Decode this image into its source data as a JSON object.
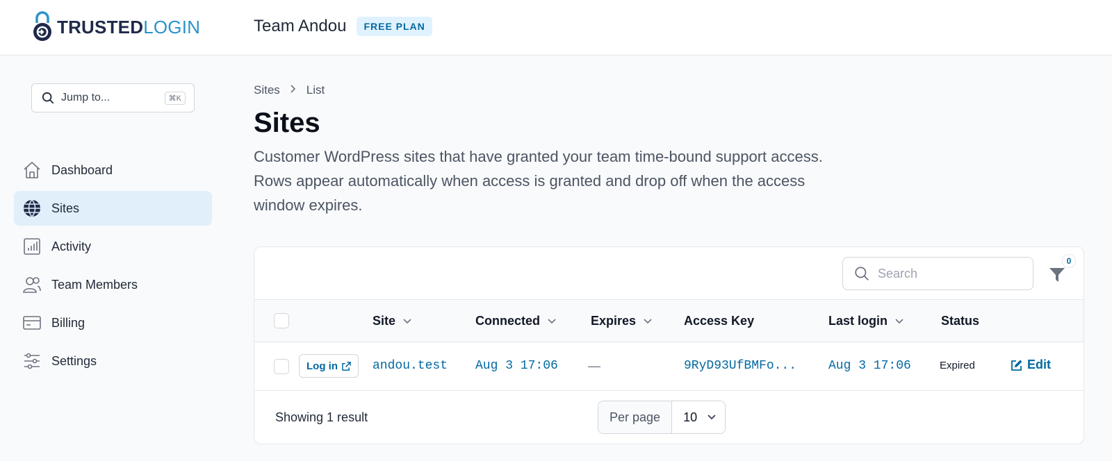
{
  "header": {
    "logo_part1": "TRUSTED",
    "logo_part2": "LOGIN",
    "team_name": "Team Andou",
    "plan_badge": "FREE PLAN"
  },
  "sidebar": {
    "jump_placeholder": "Jump to...",
    "jump_shortcut": "⌘K",
    "items": [
      {
        "label": "Dashboard",
        "icon": "home-icon",
        "active": false
      },
      {
        "label": "Sites",
        "icon": "globe-icon",
        "active": true
      },
      {
        "label": "Activity",
        "icon": "bar-chart-icon",
        "active": false
      },
      {
        "label": "Team Members",
        "icon": "users-icon",
        "active": false
      },
      {
        "label": "Billing",
        "icon": "credit-card-icon",
        "active": false
      },
      {
        "label": "Settings",
        "icon": "sliders-icon",
        "active": false
      }
    ]
  },
  "breadcrumb": {
    "items": [
      "Sites",
      "List"
    ]
  },
  "page": {
    "title": "Sites",
    "description": "Customer WordPress sites that have granted your team time-bound support access. Rows appear automatically when access is granted and drop off when the access window expires."
  },
  "table": {
    "search_placeholder": "Search",
    "filter_count": "0",
    "columns": [
      "Site",
      "Connected",
      "Expires",
      "Access Key",
      "Last login",
      "Status"
    ],
    "rows": [
      {
        "login_label": "Log in",
        "site": "andou.test",
        "connected": "Aug 3 17:06",
        "expires": "—",
        "access_key": "9RyD93UfBMFo...",
        "last_login": "Aug 3 17:06",
        "status": "Expired",
        "edit_label": "Edit"
      }
    ],
    "showing": "Showing 1 result",
    "per_page_label": "Per page",
    "per_page_value": "10"
  },
  "colors": {
    "accent": "#0369a1",
    "active_nav": "#e0effa",
    "logo_dark": "#1f2a4a",
    "logo_light": "#2a93c9"
  }
}
